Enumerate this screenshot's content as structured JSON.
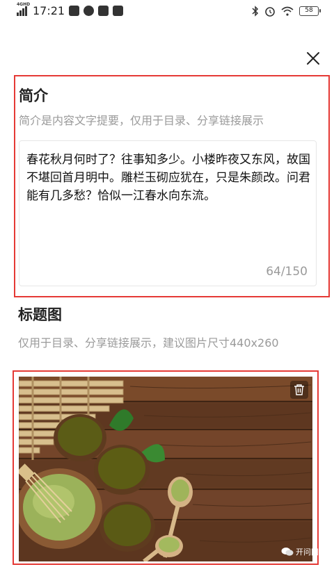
{
  "status_bar": {
    "network": "4GHD",
    "time": "17:21",
    "battery": "58"
  },
  "summary": {
    "title": "简介",
    "hint": "简介是内容文字提要，仅用于目录、分享链接展示",
    "text": "春花秋月何时了？往事知多少。小楼昨夜又东风，故国不堪回首月明中。雕栏玉砌应犹在，只是朱颜改。问君能有几多愁？恰似一江春水向东流。",
    "counter": "64/150"
  },
  "cover": {
    "title": "标题图",
    "hint": "仅用于目录、分享链接展示，建议图片尺寸440x260"
  },
  "watermark": "开问网",
  "colors": {
    "highlight_border": "#e53935",
    "hint_text": "#9a9a9a"
  },
  "icons": [
    "close-icon",
    "trash-icon",
    "wifi-icon",
    "bluetooth-icon",
    "alarm-icon"
  ]
}
